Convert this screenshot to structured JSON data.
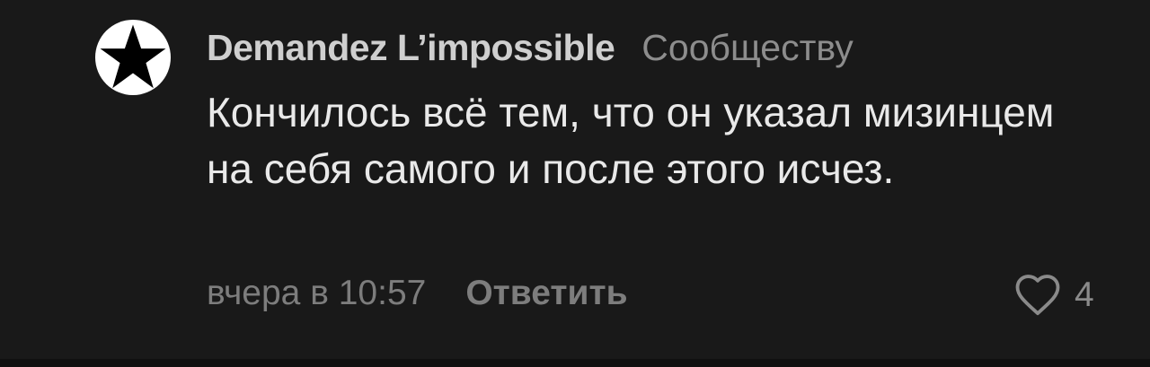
{
  "comment": {
    "author": "Demandez L’impossible",
    "reply_to": "Сообществу",
    "text": "Кончилось всё тем, что он указал мизинцем на себя самого и после этого исчез.",
    "time": "вчера в 10:57",
    "reply_label": "Ответить",
    "like_count": "4",
    "avatar_icon": "star-icon",
    "like_icon": "heart-outline-icon"
  },
  "colors": {
    "background": "#191919",
    "author": "#cfcfcf",
    "text": "#e9e9e9",
    "secondary": "#7d7d7d"
  }
}
